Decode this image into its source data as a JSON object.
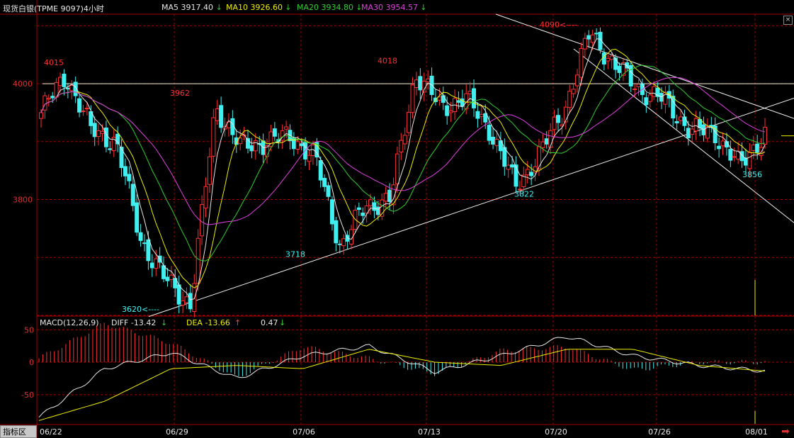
{
  "window": {
    "title": "现货白银(TPME 9097)4小时",
    "close_icon": "close-icon",
    "tab_label": "指标区",
    "next_icon": "arrow-right-icon"
  },
  "ma_legend": [
    {
      "label": "MA5 3917.40",
      "arrow": "↓",
      "color": "#e8e8e8"
    },
    {
      "label": "MA10 3926.60",
      "arrow": "↓",
      "color": "#f0f000"
    },
    {
      "label": "MA20 3934.80",
      "arrow": "↓",
      "color": "#30d030"
    },
    {
      "label": "MA30 3954.57",
      "arrow": "↓",
      "color": "#e040e0"
    }
  ],
  "macd_legend": {
    "title": "MACD(12,26,9)",
    "diff": "DIFF  -13.42",
    "diff_arrow": "↓",
    "dea": "DEA  -13.66",
    "dea_arrow": "↑",
    "macd": "0.47",
    "macd_arrow": "↓"
  },
  "chart_data": [
    {
      "type": "candlestick",
      "title": "现货白银(TPME 9097)4小时",
      "y_ticks": [
        "4000",
        "3800"
      ],
      "ylim": [
        3600,
        4120
      ],
      "x_ticks": [
        "06/22",
        "06/29",
        "07/06",
        "07/13",
        "07/20",
        "07/26",
        "08/01"
      ],
      "grid": true,
      "annotations": [
        {
          "text": "4015",
          "value": 4015
        },
        {
          "text": "3962",
          "value": 3962
        },
        {
          "text": "3620<----",
          "value": 3620
        },
        {
          "text": "3718",
          "value": 3718
        },
        {
          "text": "4018",
          "value": 4018
        },
        {
          "text": "3822",
          "value": 3822
        },
        {
          "text": "4090<----",
          "value": 4090
        },
        {
          "text": "3856",
          "value": 3856
        }
      ],
      "series": [
        {
          "name": "MA5",
          "value": 3917.4,
          "color": "#e8e8e8"
        },
        {
          "name": "MA10",
          "value": 3926.6,
          "color": "#f0f000"
        },
        {
          "name": "MA20",
          "value": 3934.8,
          "color": "#30d030"
        },
        {
          "name": "MA30",
          "value": 3954.57,
          "color": "#e040e0"
        }
      ],
      "anchors": [
        {
          "date": "06/22",
          "close": 3950
        },
        {
          "date": "06/22",
          "close": 4015
        },
        {
          "date": "06/23",
          "close": 3920
        },
        {
          "date": "06/24",
          "close": 3900
        },
        {
          "date": "06/25",
          "close": 3730
        },
        {
          "date": "06/26",
          "close": 3660
        },
        {
          "date": "06/27",
          "close": 3620
        },
        {
          "date": "06/29",
          "close": 3962
        },
        {
          "date": "06/30",
          "close": 3890
        },
        {
          "date": "07/01",
          "close": 3900
        },
        {
          "date": "07/02",
          "close": 3910
        },
        {
          "date": "07/04",
          "close": 3870
        },
        {
          "date": "07/06",
          "close": 3718
        },
        {
          "date": "07/07",
          "close": 3790
        },
        {
          "date": "07/09",
          "close": 3800
        },
        {
          "date": "07/11",
          "close": 4018
        },
        {
          "date": "07/13",
          "close": 3960
        },
        {
          "date": "07/15",
          "close": 3975
        },
        {
          "date": "07/16",
          "close": 3920
        },
        {
          "date": "07/17",
          "close": 3822
        },
        {
          "date": "07/18",
          "close": 3880
        },
        {
          "date": "07/20",
          "close": 3960
        },
        {
          "date": "07/21",
          "close": 4090
        },
        {
          "date": "07/22",
          "close": 4030
        },
        {
          "date": "07/24",
          "close": 3990
        },
        {
          "date": "07/26",
          "close": 3970
        },
        {
          "date": "07/28",
          "close": 3920
        },
        {
          "date": "07/30",
          "close": 3915
        },
        {
          "date": "07/31",
          "close": 3856
        },
        {
          "date": "08/01",
          "close": 3917
        }
      ]
    },
    {
      "type": "bar",
      "title": "MACD(12,26,9)",
      "y_ticks": [
        "50",
        "0",
        "-50"
      ],
      "ylim": [
        -95,
        70
      ],
      "series": [
        {
          "name": "DIFF",
          "value": -13.42,
          "color": "#e8e8e8"
        },
        {
          "name": "DEA",
          "value": -13.66,
          "color": "#f0f000"
        },
        {
          "name": "MACD",
          "value": 0.47
        }
      ],
      "anchors": [
        {
          "date": "06/22",
          "dif": -85,
          "dea": -90
        },
        {
          "date": "06/29",
          "dif": -10,
          "dea": -60
        },
        {
          "date": "07/01",
          "dif": 15,
          "dea": -10
        },
        {
          "date": "07/06",
          "dif": -25,
          "dea": -5
        },
        {
          "date": "07/11",
          "dif": 10,
          "dea": -10
        },
        {
          "date": "07/13",
          "dif": 25,
          "dea": 20
        },
        {
          "date": "07/17",
          "dif": -15,
          "dea": 0
        },
        {
          "date": "07/20",
          "dif": 10,
          "dea": -5
        },
        {
          "date": "07/21",
          "dif": 40,
          "dea": 20
        },
        {
          "date": "07/26",
          "dif": 10,
          "dea": 20
        },
        {
          "date": "07/29",
          "dif": -5,
          "dea": -5
        },
        {
          "date": "08/01",
          "dif": -13.42,
          "dea": -13.66
        }
      ]
    }
  ]
}
